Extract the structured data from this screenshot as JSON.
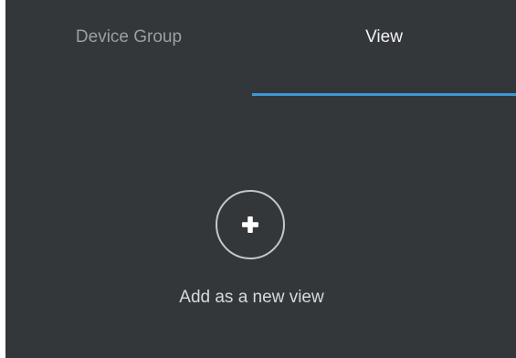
{
  "tabs": [
    {
      "label": "Device Group"
    },
    {
      "label": "View",
      "active": true
    }
  ],
  "accent_color": "#3f97d8",
  "panel_color": "#34373a",
  "empty_state": {
    "icon": "plus-icon",
    "label": "Add as a new view"
  }
}
